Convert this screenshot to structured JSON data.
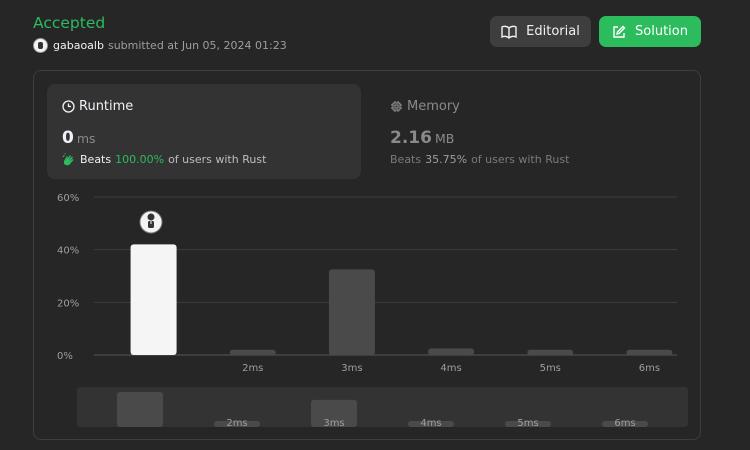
{
  "header": {
    "status": "Accepted",
    "username": "gabaoalb",
    "submitted_text": "submitted at Jun 05, 2024 01:23",
    "editorial_label": "Editorial",
    "solution_label": "Solution"
  },
  "runtime": {
    "title": "Runtime",
    "value": "0",
    "unit": "ms",
    "beats_label": "Beats",
    "beats_pct": "100.00%",
    "beats_tail": "of users with Rust"
  },
  "memory": {
    "title": "Memory",
    "value": "2.16",
    "unit": "MB",
    "beats_label": "Beats",
    "beats_pct": "35.75%",
    "beats_tail": "of users with Rust"
  },
  "colors": {
    "accent": "#2cbb5d",
    "bar_selected": "#f5f5f5",
    "bar_other": "#4a4a4a",
    "grid": "#3e3e3e"
  },
  "chart_data": [
    {
      "type": "bar",
      "categories": [
        "",
        "2ms",
        "3ms",
        "4ms",
        "5ms",
        "6ms"
      ],
      "values": [
        42,
        2,
        32.5,
        2.5,
        2,
        2
      ],
      "selected_index": 0,
      "ylim": [
        0,
        60
      ],
      "yticks": [
        "0%",
        "20%",
        "40%",
        "60%"
      ],
      "grid": true
    },
    {
      "type": "bar",
      "categories": [
        "",
        "2ms",
        "3ms",
        "4ms",
        "5ms",
        "6ms"
      ],
      "values": [
        42,
        2,
        32.5,
        2.5,
        2,
        2
      ],
      "ylim": [
        0,
        42
      ],
      "grid": false
    }
  ]
}
